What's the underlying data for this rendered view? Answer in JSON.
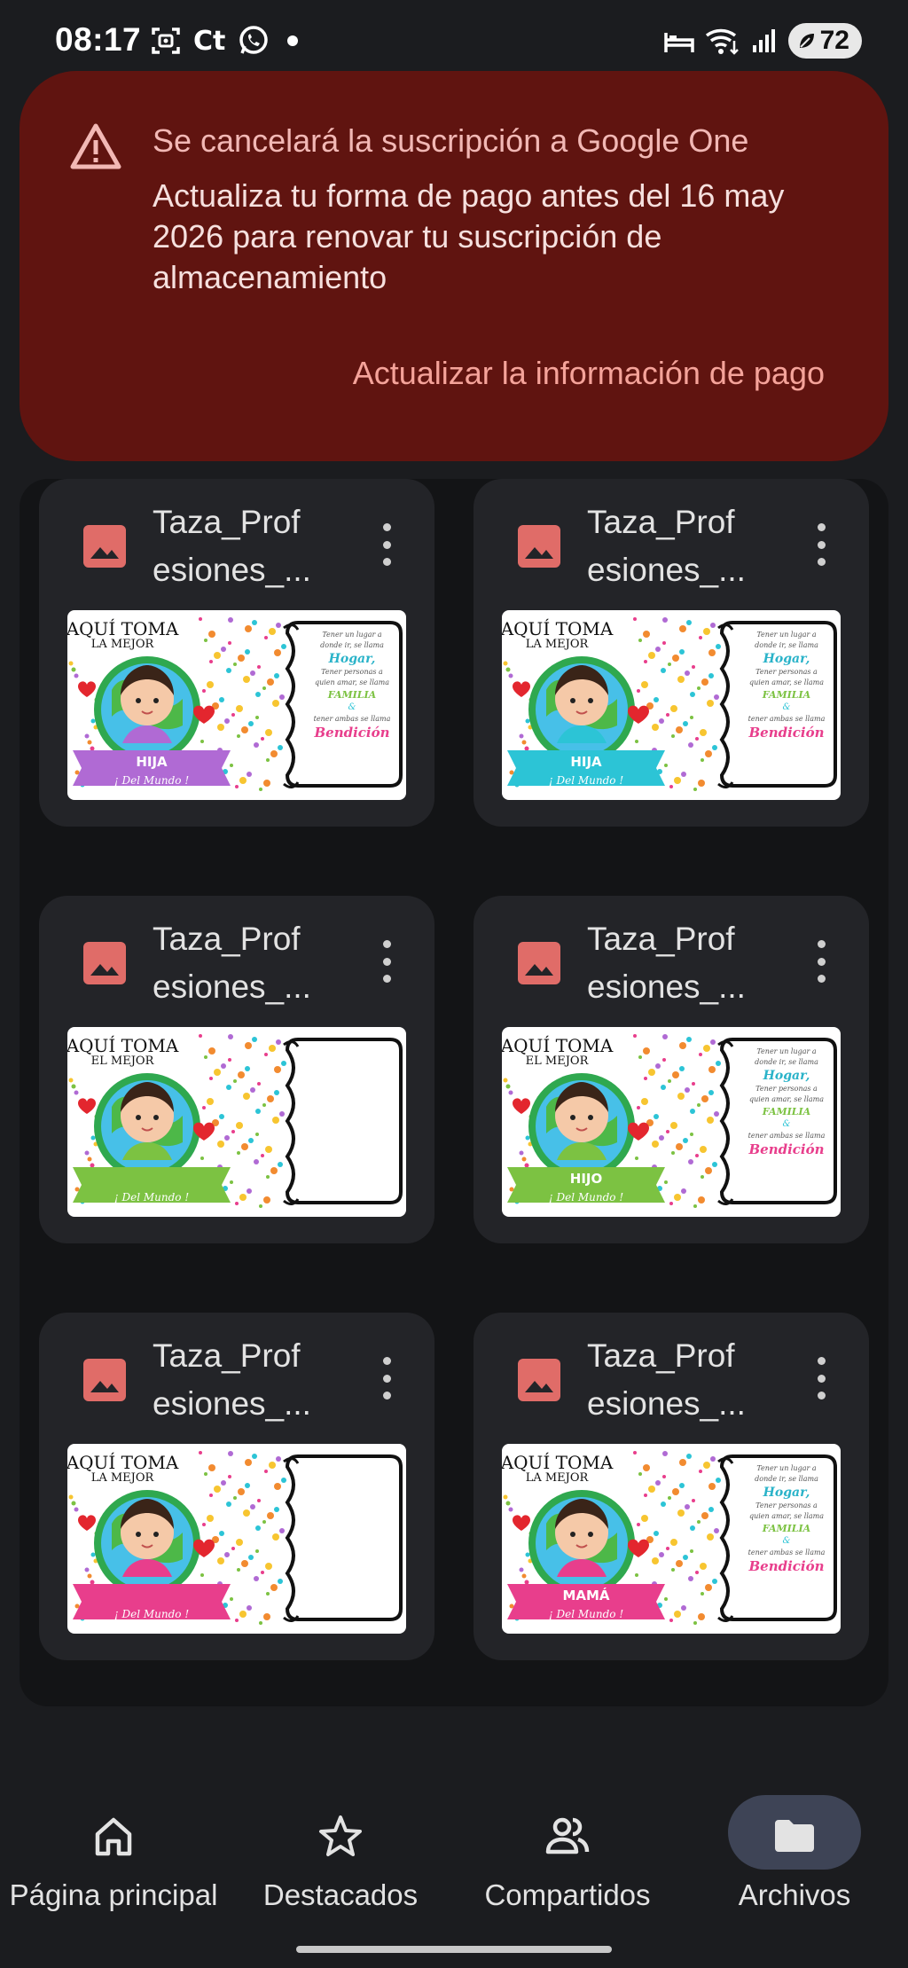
{
  "status_bar": {
    "time": "08:17",
    "left_icons": [
      "screenshot-icon",
      "ct-icon",
      "whatsapp-icon",
      "dot-icon"
    ],
    "ct_text": "Ct",
    "battery_level": "72"
  },
  "banner": {
    "title": "Se cancelará la suscripción a Google One",
    "body": "Actualiza tu forma de pago antes del 16 may 2026 para renovar tu suscripción de almacenamiento",
    "action": "Actualizar la información de pago",
    "background": "#601410",
    "icon": "warning-icon"
  },
  "files": [
    {
      "name": "Taza_Profesiones_...",
      "line1": "Taza_Prof",
      "line2": "esiones_...",
      "heading1": "AQUÍ TOMA",
      "heading2": "LA MEJOR",
      "ribbon": "HIJA",
      "sub": "¡ Del Mundo !",
      "ribbon_color": "#b06ad4",
      "has_poem": true
    },
    {
      "name": "Taza_Profesiones_...",
      "line1": "Taza_Prof",
      "line2": "esiones_...",
      "heading1": "AQUÍ TOMA",
      "heading2": "LA MEJOR",
      "ribbon": "HIJA",
      "sub": "¡ Del Mundo !",
      "ribbon_color": "#2cc4d6",
      "has_poem": true
    },
    {
      "name": "Taza_Profesiones_...",
      "line1": "Taza_Prof",
      "line2": "esiones_...",
      "heading1": "AQUÍ TOMA",
      "heading2": "EL MEJOR",
      "ribbon": "",
      "sub": "¡ Del Mundo !",
      "ribbon_color": "#7cc242",
      "has_poem": false
    },
    {
      "name": "Taza_Profesiones_...",
      "line1": "Taza_Prof",
      "line2": "esiones_...",
      "heading1": "AQUÍ TOMA",
      "heading2": "EL MEJOR",
      "ribbon": "HIJO",
      "sub": "¡ Del Mundo !",
      "ribbon_color": "#7cc242",
      "has_poem": true
    },
    {
      "name": "Taza_Profesiones_...",
      "line1": "Taza_Prof",
      "line2": "esiones_...",
      "heading1": "AQUÍ TOMA",
      "heading2": "LA MEJOR",
      "ribbon": "",
      "sub": "¡ Del Mundo !",
      "ribbon_color": "#e83e8c",
      "has_poem": false
    },
    {
      "name": "Taza_Profesiones_...",
      "line1": "Taza_Prof",
      "line2": "esiones_...",
      "heading1": "AQUÍ TOMA",
      "heading2": "LA MEJOR",
      "ribbon": "MAMÁ",
      "sub": "¡ Del Mundo !",
      "ribbon_color": "#e83e8c",
      "has_poem": true
    }
  ],
  "poem": {
    "line1": "Tener un lugar a",
    "line2": "donde ir, se llama",
    "line3": "Hogar,",
    "line4": "Tener personas a",
    "line5": "quien amar, se llama",
    "line6": "FAMILIA",
    "line7": "&",
    "line8": "tener ambas se llama",
    "line9": "Bendición"
  },
  "nav": {
    "items": [
      {
        "label": "Página principal",
        "icon": "home-icon"
      },
      {
        "label": "Destacados",
        "icon": "star-icon"
      },
      {
        "label": "Compartidos",
        "icon": "people-icon"
      },
      {
        "label": "Archivos",
        "icon": "folder-icon",
        "active": true
      }
    ]
  },
  "colors": {
    "background": "#1b1c1f",
    "card": "#232428",
    "image_icon": "#e06c68",
    "nav_active": "#3e4456"
  }
}
